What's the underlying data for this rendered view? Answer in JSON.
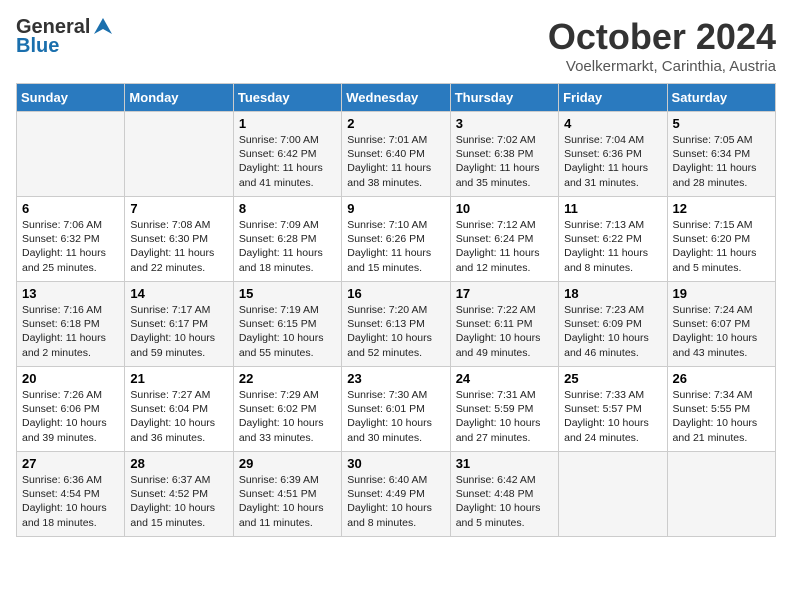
{
  "header": {
    "logo_general": "General",
    "logo_blue": "Blue",
    "month_title": "October 2024",
    "location": "Voelkermarkt, Carinthia, Austria"
  },
  "days_of_week": [
    "Sunday",
    "Monday",
    "Tuesday",
    "Wednesday",
    "Thursday",
    "Friday",
    "Saturday"
  ],
  "weeks": [
    [
      {
        "day": "",
        "info": ""
      },
      {
        "day": "",
        "info": ""
      },
      {
        "day": "1",
        "info": "Sunrise: 7:00 AM\nSunset: 6:42 PM\nDaylight: 11 hours and 41 minutes."
      },
      {
        "day": "2",
        "info": "Sunrise: 7:01 AM\nSunset: 6:40 PM\nDaylight: 11 hours and 38 minutes."
      },
      {
        "day": "3",
        "info": "Sunrise: 7:02 AM\nSunset: 6:38 PM\nDaylight: 11 hours and 35 minutes."
      },
      {
        "day": "4",
        "info": "Sunrise: 7:04 AM\nSunset: 6:36 PM\nDaylight: 11 hours and 31 minutes."
      },
      {
        "day": "5",
        "info": "Sunrise: 7:05 AM\nSunset: 6:34 PM\nDaylight: 11 hours and 28 minutes."
      }
    ],
    [
      {
        "day": "6",
        "info": "Sunrise: 7:06 AM\nSunset: 6:32 PM\nDaylight: 11 hours and 25 minutes."
      },
      {
        "day": "7",
        "info": "Sunrise: 7:08 AM\nSunset: 6:30 PM\nDaylight: 11 hours and 22 minutes."
      },
      {
        "day": "8",
        "info": "Sunrise: 7:09 AM\nSunset: 6:28 PM\nDaylight: 11 hours and 18 minutes."
      },
      {
        "day": "9",
        "info": "Sunrise: 7:10 AM\nSunset: 6:26 PM\nDaylight: 11 hours and 15 minutes."
      },
      {
        "day": "10",
        "info": "Sunrise: 7:12 AM\nSunset: 6:24 PM\nDaylight: 11 hours and 12 minutes."
      },
      {
        "day": "11",
        "info": "Sunrise: 7:13 AM\nSunset: 6:22 PM\nDaylight: 11 hours and 8 minutes."
      },
      {
        "day": "12",
        "info": "Sunrise: 7:15 AM\nSunset: 6:20 PM\nDaylight: 11 hours and 5 minutes."
      }
    ],
    [
      {
        "day": "13",
        "info": "Sunrise: 7:16 AM\nSunset: 6:18 PM\nDaylight: 11 hours and 2 minutes."
      },
      {
        "day": "14",
        "info": "Sunrise: 7:17 AM\nSunset: 6:17 PM\nDaylight: 10 hours and 59 minutes."
      },
      {
        "day": "15",
        "info": "Sunrise: 7:19 AM\nSunset: 6:15 PM\nDaylight: 10 hours and 55 minutes."
      },
      {
        "day": "16",
        "info": "Sunrise: 7:20 AM\nSunset: 6:13 PM\nDaylight: 10 hours and 52 minutes."
      },
      {
        "day": "17",
        "info": "Sunrise: 7:22 AM\nSunset: 6:11 PM\nDaylight: 10 hours and 49 minutes."
      },
      {
        "day": "18",
        "info": "Sunrise: 7:23 AM\nSunset: 6:09 PM\nDaylight: 10 hours and 46 minutes."
      },
      {
        "day": "19",
        "info": "Sunrise: 7:24 AM\nSunset: 6:07 PM\nDaylight: 10 hours and 43 minutes."
      }
    ],
    [
      {
        "day": "20",
        "info": "Sunrise: 7:26 AM\nSunset: 6:06 PM\nDaylight: 10 hours and 39 minutes."
      },
      {
        "day": "21",
        "info": "Sunrise: 7:27 AM\nSunset: 6:04 PM\nDaylight: 10 hours and 36 minutes."
      },
      {
        "day": "22",
        "info": "Sunrise: 7:29 AM\nSunset: 6:02 PM\nDaylight: 10 hours and 33 minutes."
      },
      {
        "day": "23",
        "info": "Sunrise: 7:30 AM\nSunset: 6:01 PM\nDaylight: 10 hours and 30 minutes."
      },
      {
        "day": "24",
        "info": "Sunrise: 7:31 AM\nSunset: 5:59 PM\nDaylight: 10 hours and 27 minutes."
      },
      {
        "day": "25",
        "info": "Sunrise: 7:33 AM\nSunset: 5:57 PM\nDaylight: 10 hours and 24 minutes."
      },
      {
        "day": "26",
        "info": "Sunrise: 7:34 AM\nSunset: 5:55 PM\nDaylight: 10 hours and 21 minutes."
      }
    ],
    [
      {
        "day": "27",
        "info": "Sunrise: 6:36 AM\nSunset: 4:54 PM\nDaylight: 10 hours and 18 minutes."
      },
      {
        "day": "28",
        "info": "Sunrise: 6:37 AM\nSunset: 4:52 PM\nDaylight: 10 hours and 15 minutes."
      },
      {
        "day": "29",
        "info": "Sunrise: 6:39 AM\nSunset: 4:51 PM\nDaylight: 10 hours and 11 minutes."
      },
      {
        "day": "30",
        "info": "Sunrise: 6:40 AM\nSunset: 4:49 PM\nDaylight: 10 hours and 8 minutes."
      },
      {
        "day": "31",
        "info": "Sunrise: 6:42 AM\nSunset: 4:48 PM\nDaylight: 10 hours and 5 minutes."
      },
      {
        "day": "",
        "info": ""
      },
      {
        "day": "",
        "info": ""
      }
    ]
  ]
}
